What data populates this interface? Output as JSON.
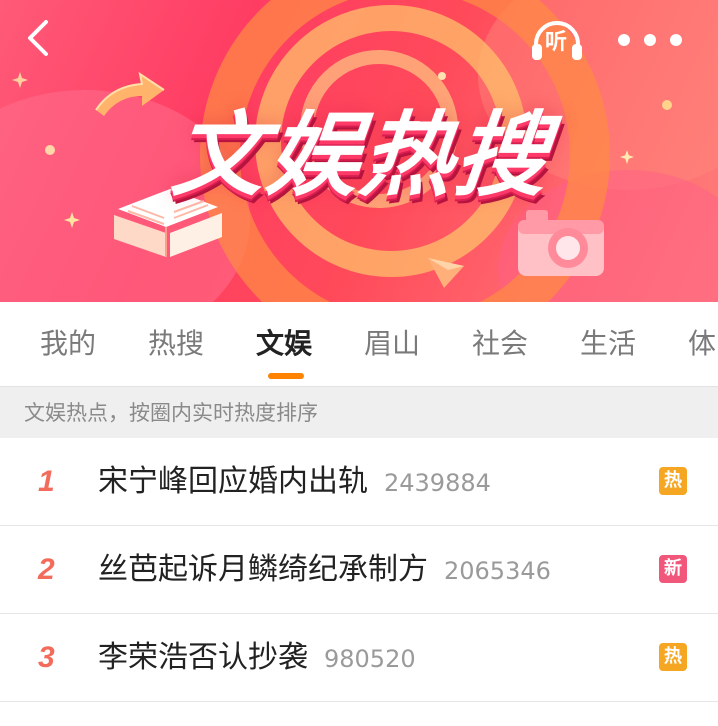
{
  "banner": {
    "title": "文娱热搜",
    "listen_label": "听",
    "colors": {
      "primary": "#ff3d63",
      "accent": "#ff8200"
    }
  },
  "header": {
    "back_icon": "chevron-left-icon",
    "listen_icon": "headphones-icon",
    "more_icon": "more-horizontal-icon"
  },
  "tabs": [
    {
      "label": "我的",
      "active": false
    },
    {
      "label": "热搜",
      "active": false
    },
    {
      "label": "文娱",
      "active": true
    },
    {
      "label": "眉山",
      "active": false
    },
    {
      "label": "社会",
      "active": false
    },
    {
      "label": "生活",
      "active": false
    },
    {
      "label": "体",
      "active": false
    }
  ],
  "subheader": {
    "text": "文娱热点，按圈内实时热度排序"
  },
  "list": [
    {
      "rank": "1",
      "title": "宋宁峰回应婚内出轨",
      "count": "2439884",
      "badge": "热",
      "badge_color": "#f5a623"
    },
    {
      "rank": "2",
      "title": "丝芭起诉月鳞绮纪承制方",
      "count": "2065346",
      "badge": "新",
      "badge_color": "#f0577a"
    },
    {
      "rank": "3",
      "title": "李荣浩否认抄袭",
      "count": "980520",
      "badge": "热",
      "badge_color": "#f5a623"
    }
  ]
}
